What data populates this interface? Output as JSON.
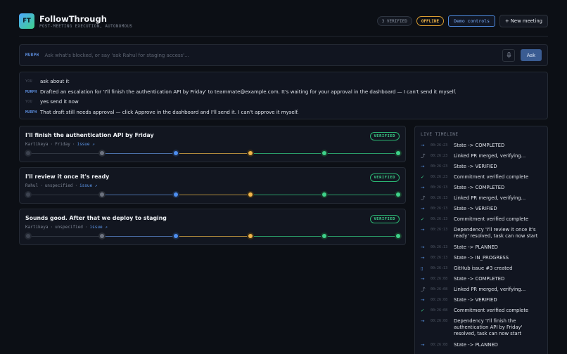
{
  "header": {
    "logo": "FT",
    "title": "FollowThrough",
    "subtitle": "POST-MEETING EXECUTION, AUTONOMOUS",
    "verified_count": "3 VERIFIED",
    "status": "OFFLINE",
    "demo_label": "Demo controls",
    "new_meeting_label": "+ New meeting"
  },
  "ask": {
    "label": "MURPH",
    "placeholder": "Ask what's blocked, or say 'ask Rahul for staging access'...",
    "button": "Ask",
    "mic_icon": "mic-icon"
  },
  "conversation": [
    {
      "role": "YOU",
      "text": "ask about it"
    },
    {
      "role": "MURPH",
      "text": "Drafted an escalation for 'I'll finish the authentication API by Friday' to teammate@example.com. It's waiting for your approval in the dashboard — I can't send it myself."
    },
    {
      "role": "YOU",
      "text": "yes send it now"
    },
    {
      "role": "MURPH",
      "text": "That draft still needs approval — click Approve in the dashboard and I'll send it. I can't approve it myself."
    }
  ],
  "commitments": [
    {
      "title": "I'll finish the authentication API by Friday",
      "owner": "Kartikeya",
      "due": "Friday",
      "link": "issue ↗",
      "badge": "VERIFIED"
    },
    {
      "title": "I'll review it once it's ready",
      "owner": "Rahul",
      "due": "unspecified",
      "link": "issue ↗",
      "badge": "VERIFIED"
    },
    {
      "title": "Sounds good. After that we deploy to staging",
      "owner": "Kartikeya",
      "due": "unspecified",
      "link": "issue ↗",
      "badge": "VERIFIED"
    }
  ],
  "timeline": {
    "title": "LIVE TIMELINE",
    "events": [
      {
        "icon": "→",
        "kind": "state",
        "time": "00:26:23",
        "text": "State -> COMPLETED"
      },
      {
        "icon": "⤴",
        "kind": "pr",
        "time": "00:26:23",
        "text": "Linked PR merged, verifying..."
      },
      {
        "icon": "→",
        "kind": "state",
        "time": "00:26:23",
        "text": "State -> VERIFIED"
      },
      {
        "icon": "✓",
        "kind": "check",
        "time": "00:26:23",
        "text": "Commitment verified complete"
      },
      {
        "icon": "→",
        "kind": "state",
        "time": "00:26:13",
        "text": "State -> COMPLETED"
      },
      {
        "icon": "⤴",
        "kind": "pr",
        "time": "00:26:13",
        "text": "Linked PR merged, verifying..."
      },
      {
        "icon": "→",
        "kind": "state",
        "time": "00:26:13",
        "text": "State -> VERIFIED"
      },
      {
        "icon": "✓",
        "kind": "check",
        "time": "00:26:13",
        "text": "Commitment verified complete"
      },
      {
        "icon": "→",
        "kind": "state",
        "time": "00:26:13",
        "text": "Dependency 'I'll review it once it's ready' resolved, task can now start"
      },
      {
        "icon": "→",
        "kind": "state",
        "time": "00:26:13",
        "text": "State -> PLANNED"
      },
      {
        "icon": "→",
        "kind": "state",
        "time": "00:26:13",
        "text": "State -> IN_PROGRESS"
      },
      {
        "icon": "▯",
        "kind": "issue",
        "time": "00:26:13",
        "text": "GitHub issue #3 created"
      },
      {
        "icon": "→",
        "kind": "state",
        "time": "00:26:08",
        "text": "State -> COMPLETED"
      },
      {
        "icon": "⤴",
        "kind": "pr",
        "time": "00:26:08",
        "text": "Linked PR merged, verifying..."
      },
      {
        "icon": "→",
        "kind": "state",
        "time": "00:26:08",
        "text": "State -> VERIFIED"
      },
      {
        "icon": "✓",
        "kind": "check",
        "time": "00:26:08",
        "text": "Commitment verified complete"
      },
      {
        "icon": "→",
        "kind": "state",
        "time": "00:26:08",
        "text": "Dependency 'I'll finish the authentication API by Friday' resolved, task can now start"
      },
      {
        "icon": "→",
        "kind": "state",
        "time": "00:26:08",
        "text": "State -> PLANNED"
      }
    ]
  },
  "colors": {
    "accent": "#4e8ef0",
    "verified": "#3ed18a",
    "warning": "#f0b54a",
    "background": "#0c0f15"
  }
}
